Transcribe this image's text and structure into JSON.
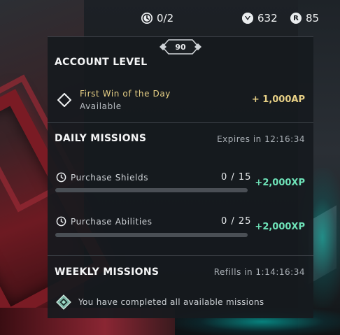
{
  "topbar": {
    "missions_value": "0/2",
    "vp_value": "632",
    "radianite_value": "85",
    "radianite_icon_glyph": "R"
  },
  "account": {
    "level": "90",
    "title": "ACCOUNT LEVEL",
    "first_win_title": "First Win of the Day",
    "first_win_status": "Available",
    "first_win_reward": "+ 1,000AP"
  },
  "daily": {
    "title": "DAILY MISSIONS",
    "expires": "Expires in 12:16:34",
    "missions": [
      {
        "label": "Purchase Shields",
        "count": "0 / 15",
        "progress": 0,
        "reward": "+2,000XP"
      },
      {
        "label": "Purchase Abilities",
        "count": "0 / 25",
        "progress": 0,
        "reward": "+2,000XP"
      }
    ]
  },
  "weekly": {
    "title": "WEEKLY MISSIONS",
    "refills": "Refills in 1:14:16:34",
    "completed_message": "You have completed all available missions"
  },
  "colors": {
    "gold": "#e6cf85",
    "green": "#6ee3b8",
    "panel": "#161a1e"
  },
  "icons": [
    "clock-icon",
    "vp-icon",
    "radianite-icon",
    "diamond-icon",
    "completed-icon"
  ]
}
